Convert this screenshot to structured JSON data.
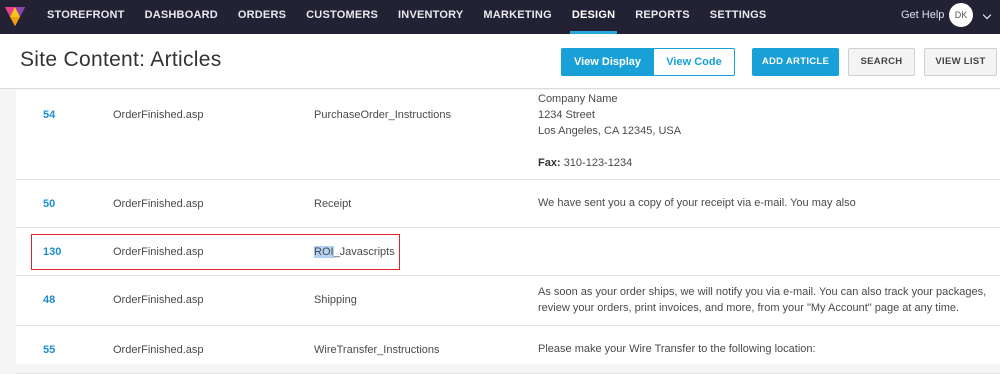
{
  "nav": {
    "items": [
      "STOREFRONT",
      "DASHBOARD",
      "ORDERS",
      "CUSTOMERS",
      "INVENTORY",
      "MARKETING",
      "DESIGN",
      "REPORTS",
      "SETTINGS"
    ],
    "active": "DESIGN",
    "get_help": "Get Help",
    "avatar_initials": "DK",
    "accent_color": "#29a8e0"
  },
  "header": {
    "title_prefix": "Site Content:",
    "title_suffix": "Articles",
    "view_display": "View Display",
    "view_code": "View Code",
    "add_article": "ADD ARTICLE",
    "search": "SEARCH",
    "view_list": "VIEW LIST"
  },
  "rows": [
    {
      "id": "54",
      "page": "OrderFinished.asp",
      "name": "PurchaseOrder_Instructions",
      "text_lines": [
        "Company Name",
        "1234 Street",
        "Los Angeles, CA 12345, USA",
        "",
        "Fax: 310-123-1234"
      ]
    },
    {
      "id": "50",
      "page": "OrderFinished.asp",
      "name": "Receipt",
      "text": "We have sent you a copy of your receipt via e-mail. You may also"
    },
    {
      "id": "130",
      "page": "OrderFinished.asp",
      "name_highlight": "ROI",
      "name_rest": "_Javascripts",
      "text": ""
    },
    {
      "id": "48",
      "page": "OrderFinished.asp",
      "name": "Shipping",
      "text_lines": [
        "As soon as your order ships, we will notify you via e-mail. You can also track your packages,",
        "review your orders, print invoices, and more, from your \"My Account\" page at any time."
      ]
    },
    {
      "id": "55",
      "page": "OrderFinished.asp",
      "name": "WireTransfer_Instructions",
      "text": "Please make your Wire Transfer to the following location:"
    }
  ],
  "fax_label": "Fax:",
  "fax_value": "310-123-1234"
}
